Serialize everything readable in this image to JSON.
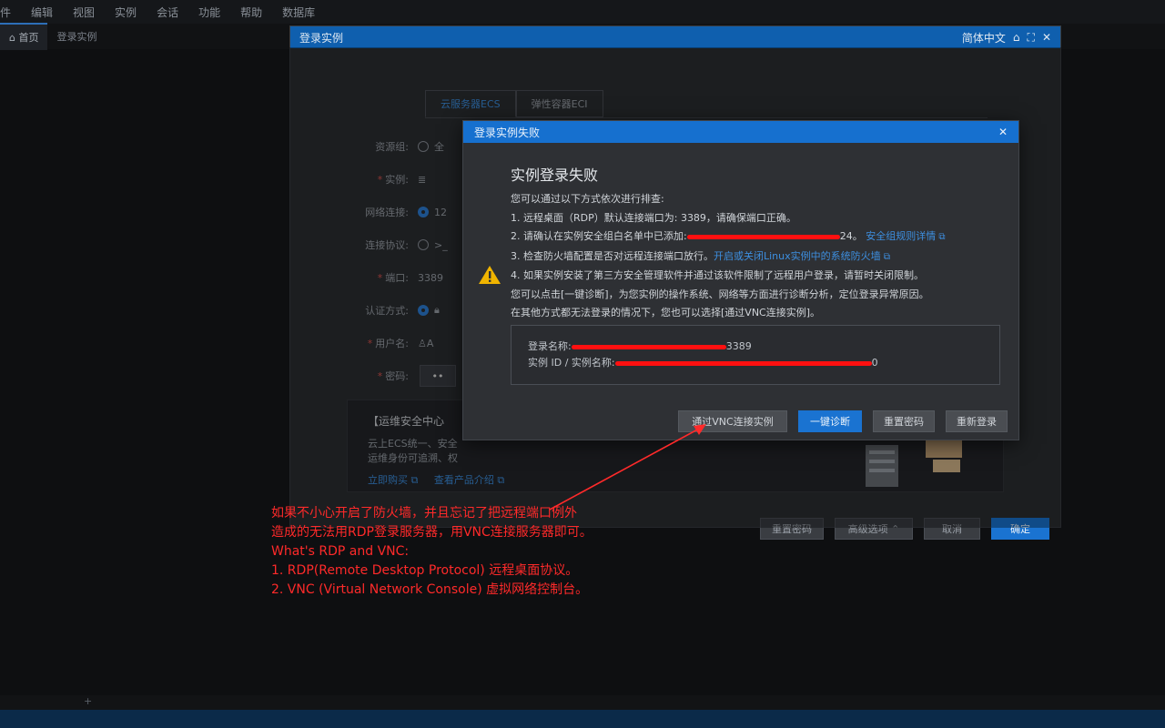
{
  "menubar": {
    "items": [
      "件",
      "编辑",
      "视图",
      "实例",
      "会话",
      "功能",
      "帮助",
      "数据库"
    ]
  },
  "tabs": [
    {
      "label": "首页"
    },
    {
      "label": "登录实例"
    }
  ],
  "login_dialog": {
    "title": "登录实例",
    "language": "简体中文",
    "segments": [
      "云服务器ECS",
      "弹性容器ECI"
    ],
    "fields": {
      "resource_group": "资源组:",
      "resource_group_value": "全",
      "instance": "实例:",
      "network": "网络连接:",
      "network_value": "12",
      "protocol": "连接协议:",
      "port": "端口:",
      "port_value": "3389",
      "auth": "认证方式:",
      "username": "用户名:",
      "username_value": "A",
      "password": "密码:"
    },
    "promo": {
      "title": "【运维安全中心",
      "line1": "云上ECS统一、安全",
      "line2": "运维身份可追溯、权",
      "link1": "立即购买",
      "link2": "查看产品介绍"
    },
    "footer": {
      "reset_pwd": "重置密码",
      "advanced": "高级选项",
      "cancel": "取消",
      "ok": "确定"
    }
  },
  "error_dialog": {
    "title": "登录实例失败",
    "heading": "实例登录失败",
    "intro": "您可以通过以下方式依次进行排查:",
    "line1": "1. 远程桌面（RDP）默认连接端口为: 3389，请确保端口正确。",
    "line2_prefix": "2. 请确认在实例安全组白名单中已添加:",
    "line2_suffix": "24。",
    "line2_link": "安全组规则详情",
    "line3_prefix": "3. 检查防火墙配置是否对远程连接端口放行。",
    "line3_link": "开启或关闭Linux实例中的系统防火墙",
    "line4": "4. 如果实例安装了第三方安全管理软件并通过该软件限制了远程用户登录，请暂时关闭限制。",
    "line5": "您可以点击[一键诊断]，为您实例的操作系统、网络等方面进行诊断分析，定位登录异常原因。",
    "line6": "在其他方式都无法登录的情况下，您也可以选择[通过VNC连接实例]。",
    "info_login_label": "登录名称:",
    "info_login_suffix": "3389",
    "info_instance_label": "实例 ID / 实例名称:",
    "info_instance_suffix": "0",
    "buttons": {
      "vnc": "通过VNC连接实例",
      "diagnose": "一键诊断",
      "reset_pwd": "重置密码",
      "relogin": "重新登录"
    }
  },
  "annotation": {
    "line1": "如果不小心开启了防火墙，并且忘记了把远程端口例外",
    "line2": "造成的无法用RDP登录服务器，用VNC连接服务器即可。",
    "line3": "What's RDP and VNC:",
    "line4": "1. RDP(Remote Desktop Protocol) 远程桌面协议。",
    "line5": "2. VNC (Virtual Network Console) 虚拟网络控制台。"
  },
  "colors": {
    "accent": "#1a73d1",
    "annotation": "#ff2a2a",
    "warning": "#f0b400"
  },
  "icons": {
    "warning": "warning-icon",
    "close": "close-icon",
    "external": "external-link-icon"
  }
}
